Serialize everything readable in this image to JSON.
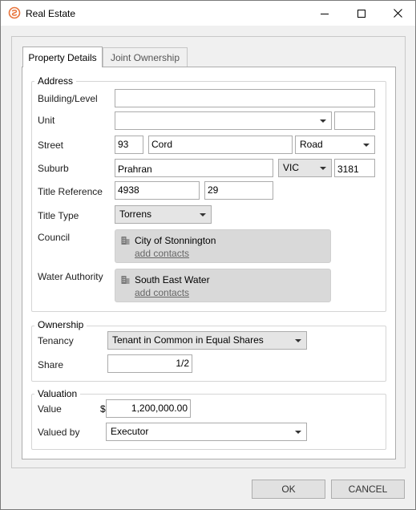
{
  "window": {
    "title": "Real Estate"
  },
  "tabs": [
    {
      "label": "Property Details"
    },
    {
      "label": "Joint Ownership"
    }
  ],
  "address": {
    "legend": "Address",
    "building_label": "Building/Level",
    "building_value": "",
    "unit_label": "Unit",
    "unit_value": "",
    "unit_suffix_value": "",
    "street_label": "Street",
    "street_number": "93",
    "street_name": "Cord",
    "street_type": "Road",
    "suburb_label": "Suburb",
    "suburb_value": "Prahran",
    "state_value": "VIC",
    "postcode_value": "3181",
    "title_ref_label": "Title Reference",
    "title_ref_volume": "4938",
    "title_ref_folio": "29",
    "title_type_label": "Title Type",
    "title_type_value": "Torrens",
    "council_label": "Council",
    "council_name": "City of Stonnington",
    "council_link": "add contacts",
    "water_label": "Water Authority",
    "water_name": "South East Water",
    "water_link": "add contacts"
  },
  "ownership": {
    "legend": "Ownership",
    "tenancy_label": "Tenancy",
    "tenancy_value": "Tenant in Common in Equal Shares",
    "share_label": "Share",
    "share_value": "1/2"
  },
  "valuation": {
    "legend": "Valuation",
    "value_label": "Value",
    "currency_symbol": "$",
    "value_amount": "1,200,000.00",
    "valued_by_label": "Valued by",
    "valued_by_value": "Executor"
  },
  "buttons": {
    "ok": "OK",
    "cancel": "CANCEL"
  },
  "icons": {
    "app": "app-logo-icon",
    "minimize": "minimize-icon",
    "maximize": "maximize-icon",
    "close": "close-icon",
    "building": "building-icon"
  },
  "colors": {
    "accent": "#e8743b",
    "card": "#d9d9d9"
  }
}
